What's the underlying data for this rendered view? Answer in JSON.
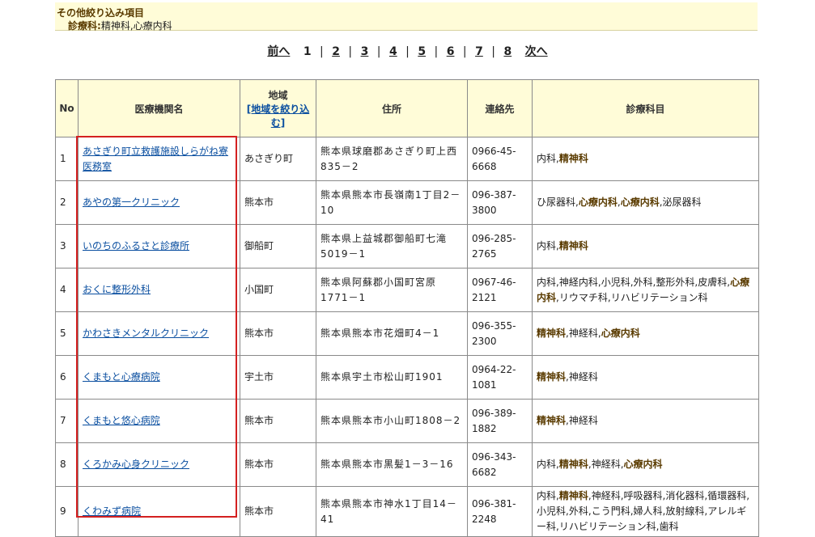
{
  "filter": {
    "title": "その他絞り込み項目",
    "label": "診療科:",
    "value": "精神科,心療内科"
  },
  "pagination": {
    "prev": "前へ",
    "current": "1",
    "pages": [
      "2",
      "3",
      "4",
      "5",
      "6",
      "7",
      "8"
    ],
    "separator": "|",
    "next": "次へ"
  },
  "table": {
    "headers": {
      "no": "No",
      "name": "医療機関名",
      "region": "地域",
      "region_link": "[地域を絞り込む]",
      "address": "住所",
      "contact": "連絡先",
      "departments": "診療科目"
    },
    "rows": [
      {
        "no": "1",
        "name": "あさぎり町立救護施設しらがね寮 医務室",
        "region": "あさぎり町",
        "address": "熊本県球磨郡あさぎり町上西835－2",
        "phone": "0966-45-6668",
        "depts": [
          {
            "t": "内科",
            "h": false
          },
          {
            "t": "精神科",
            "h": true
          }
        ]
      },
      {
        "no": "2",
        "name": "あやの第一クリニック",
        "region": "熊本市",
        "address": "熊本県熊本市長嶺南1丁目2－10",
        "phone": "096-387-3800",
        "depts": [
          {
            "t": "ひ尿器科",
            "h": false
          },
          {
            "t": "心療内科",
            "h": true
          },
          {
            "t": "心療内科",
            "h": true
          },
          {
            "t": "泌尿器科",
            "h": false
          }
        ]
      },
      {
        "no": "3",
        "name": "いのちのふるさと診療所",
        "region": "御船町",
        "address": "熊本県上益城郡御船町七滝5019－1",
        "phone": "096-285-2765",
        "depts": [
          {
            "t": "内科",
            "h": false
          },
          {
            "t": "精神科",
            "h": true
          }
        ]
      },
      {
        "no": "4",
        "name": "おくに整形外科",
        "region": "小国町",
        "address": "熊本県阿蘇郡小国町宮原1771－1",
        "phone": "0967-46-2121",
        "depts": [
          {
            "t": "内科",
            "h": false
          },
          {
            "t": "神経内科",
            "h": false
          },
          {
            "t": "小児科",
            "h": false
          },
          {
            "t": "外科",
            "h": false
          },
          {
            "t": "整形外科",
            "h": false
          },
          {
            "t": "皮膚科",
            "h": false
          },
          {
            "t": "心療内科",
            "h": true
          },
          {
            "t": "リウマチ科",
            "h": false
          },
          {
            "t": "リハビリテーション科",
            "h": false
          }
        ]
      },
      {
        "no": "5",
        "name": "かわさきメンタルクリニック",
        "region": "熊本市",
        "address": "熊本県熊本市花畑町4－1",
        "phone": "096-355-2300",
        "depts": [
          {
            "t": "精神科",
            "h": true
          },
          {
            "t": "神経科",
            "h": false
          },
          {
            "t": "心療内科",
            "h": true
          }
        ]
      },
      {
        "no": "6",
        "name": "くまもと心療病院",
        "region": "宇土市",
        "address": "熊本県宇土市松山町1901",
        "phone": "0964-22-1081",
        "depts": [
          {
            "t": "精神科",
            "h": true
          },
          {
            "t": "神経科",
            "h": false
          }
        ]
      },
      {
        "no": "7",
        "name": "くまもと悠心病院",
        "region": "熊本市",
        "address": "熊本県熊本市小山町1808－2",
        "phone": "096-389-1882",
        "depts": [
          {
            "t": "精神科",
            "h": true
          },
          {
            "t": "神経科",
            "h": false
          }
        ]
      },
      {
        "no": "8",
        "name": "くろかみ心身クリニック",
        "region": "熊本市",
        "address": "熊本県熊本市黒髪1－3－16",
        "phone": "096-343-6682",
        "depts": [
          {
            "t": "内科",
            "h": false
          },
          {
            "t": "精神科",
            "h": true
          },
          {
            "t": "神経科",
            "h": false
          },
          {
            "t": "心療内科",
            "h": true
          }
        ]
      },
      {
        "no": "9",
        "name": "くわみず病院",
        "region": "熊本市",
        "address": "熊本県熊本市神水1丁目14－41",
        "phone": "096-381-2248",
        "depts": [
          {
            "t": "内科",
            "h": false
          },
          {
            "t": "精神科",
            "h": true
          },
          {
            "t": "神経科",
            "h": false
          },
          {
            "t": "呼吸器科",
            "h": false
          },
          {
            "t": "消化器科",
            "h": false
          },
          {
            "t": "循環器科",
            "h": false
          },
          {
            "t": "小児科",
            "h": false
          },
          {
            "t": "外科",
            "h": false
          },
          {
            "t": "こう門科",
            "h": false
          },
          {
            "t": "婦人科",
            "h": false
          },
          {
            "t": "放射線科",
            "h": false
          },
          {
            "t": "アレルギー科",
            "h": false
          },
          {
            "t": "リハビリテーション科",
            "h": false
          },
          {
            "t": "歯科",
            "h": false
          }
        ]
      }
    ]
  }
}
